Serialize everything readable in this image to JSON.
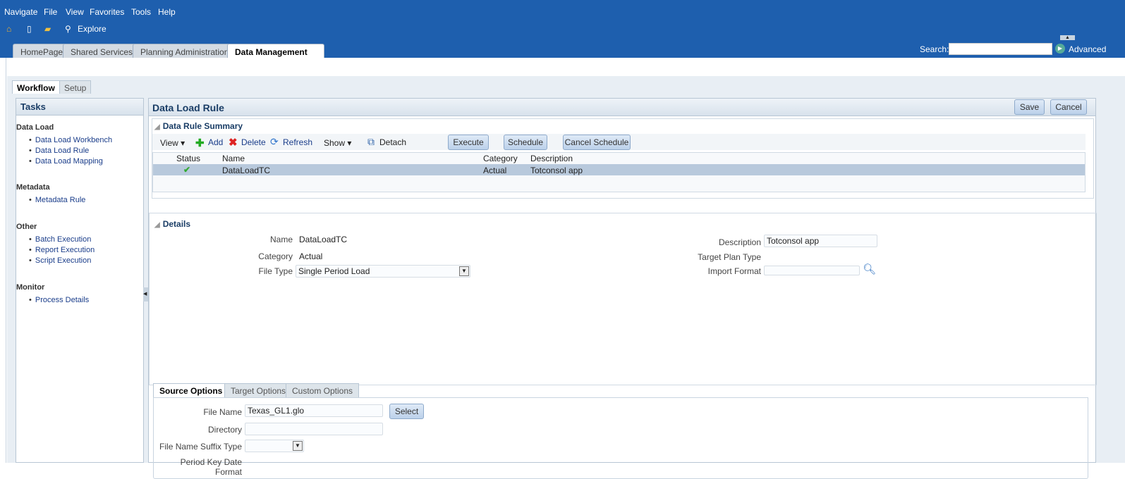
{
  "menu": [
    "Navigate",
    "File",
    "View",
    "Favorites",
    "Tools",
    "Help"
  ],
  "toolbar": {
    "explore": "Explore"
  },
  "tabs": [
    {
      "label": "HomePage"
    },
    {
      "label": "Shared Services"
    },
    {
      "label": "Planning Administration"
    },
    {
      "label": "Data Management",
      "active": true
    }
  ],
  "search": {
    "label": "Search:",
    "value": "",
    "advanced": "Advanced"
  },
  "workflow_tabs": [
    "Workflow",
    "Setup"
  ],
  "tasks": {
    "title": "Tasks",
    "sections": [
      {
        "label": "Data Load",
        "items": [
          "Data Load Workbench",
          "Data Load Rule",
          "Data Load Mapping"
        ]
      },
      {
        "label": "Metadata",
        "items": [
          "Metadata Rule"
        ]
      },
      {
        "label": "Other",
        "items": [
          "Batch Execution",
          "Report Execution",
          "Script Execution"
        ]
      },
      {
        "label": "Monitor",
        "items": [
          "Process Details"
        ]
      }
    ]
  },
  "main": {
    "title": "Data Load Rule",
    "save": "Save",
    "cancel": "Cancel",
    "summary": {
      "title": "Data Rule Summary",
      "toolbar": {
        "view": "View",
        "add": "Add",
        "delete": "Delete",
        "refresh": "Refresh",
        "show": "Show",
        "detach": "Detach",
        "execute": "Execute",
        "schedule": "Schedule",
        "cancel_schedule": "Cancel Schedule"
      },
      "columns": [
        "Status",
        "Name",
        "Category",
        "Description"
      ],
      "rows": [
        {
          "status": "success",
          "name": "DataLoadTC",
          "category": "Actual",
          "description": "Totconsol app"
        }
      ]
    },
    "details": {
      "title": "Details",
      "name_label": "Name",
      "name": "DataLoadTC",
      "category_label": "Category",
      "category": "Actual",
      "file_type_label": "File Type",
      "file_type": "Single Period Load",
      "description_label": "Description",
      "description": "Totconsol app",
      "target_plan_type_label": "Target Plan Type",
      "import_format_label": "Import Format",
      "import_format": "",
      "tabs": [
        "Source Options",
        "Target Options",
        "Custom Options"
      ],
      "source": {
        "file_name_label": "File Name",
        "file_name": "Texas_GL1.glo",
        "select": "Select",
        "directory_label": "Directory",
        "directory": "",
        "suffix_label": "File Name Suffix Type",
        "suffix": "",
        "period_key_label": "Period Key Date Format"
      }
    }
  },
  "colors": {
    "header": "#1e5fae",
    "accent": "#1a3d66"
  }
}
